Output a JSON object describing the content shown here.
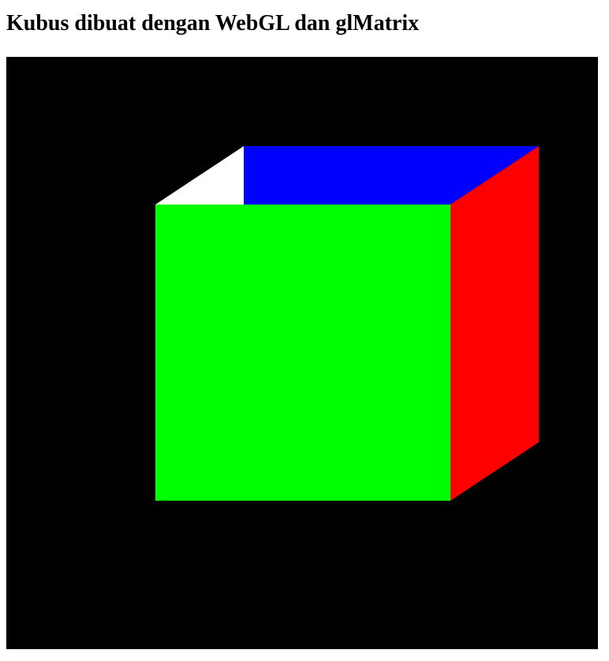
{
  "page": {
    "title": "Kubus dibuat dengan WebGL dan glMatrix"
  },
  "canvas": {
    "background_color": "#000000",
    "faces": [
      {
        "name": "front-face",
        "color": "#00ff00"
      },
      {
        "name": "right-face",
        "color": "#ff0000"
      },
      {
        "name": "top-face",
        "color": "#0000ff"
      },
      {
        "name": "left-edge-face",
        "color": "#ffffff"
      }
    ]
  }
}
